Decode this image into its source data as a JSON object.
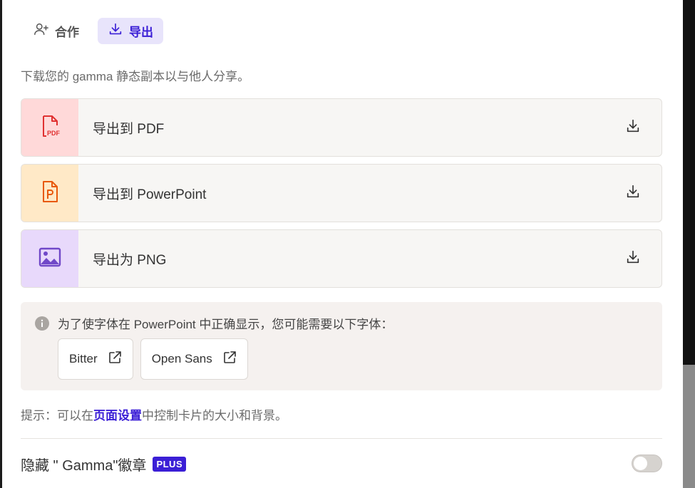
{
  "tabs": [
    {
      "label": "合作",
      "icon": "add-user-icon",
      "active": false
    },
    {
      "label": "导出",
      "icon": "download-icon",
      "active": true
    }
  ],
  "description": "下载您的 gamma 静态副本以与他人分享。",
  "exports": [
    {
      "label": "导出到 PDF",
      "icon": "pdf-file-icon",
      "bg": "#ffd9d9",
      "icon_color": "#e03131"
    },
    {
      "label": "导出到 PowerPoint",
      "icon": "powerpoint-file-icon",
      "bg": "#ffe9c7",
      "icon_color": "#e8590c"
    },
    {
      "label": "导出为 PNG",
      "icon": "image-icon",
      "bg": "#e8d9fb",
      "icon_color": "#7048c8"
    }
  ],
  "font_note": "为了使字体在 PowerPoint 中正确显示，您可能需要以下字体：",
  "fonts": [
    {
      "label": "Bitter",
      "icon": "external-link-icon"
    },
    {
      "label": "Open Sans",
      "icon": "external-link-icon"
    }
  ],
  "tip": {
    "prefix": "提示：可以在",
    "link": "页面设置",
    "suffix": "中控制卡片的大小和背景。"
  },
  "badge": {
    "label": "隐藏 \" Gamma\"徽章",
    "plus": "PLUS",
    "enabled": false
  },
  "colors": {
    "accent": "#3b1fd6",
    "active_tab_bg": "#e8e4fb"
  }
}
